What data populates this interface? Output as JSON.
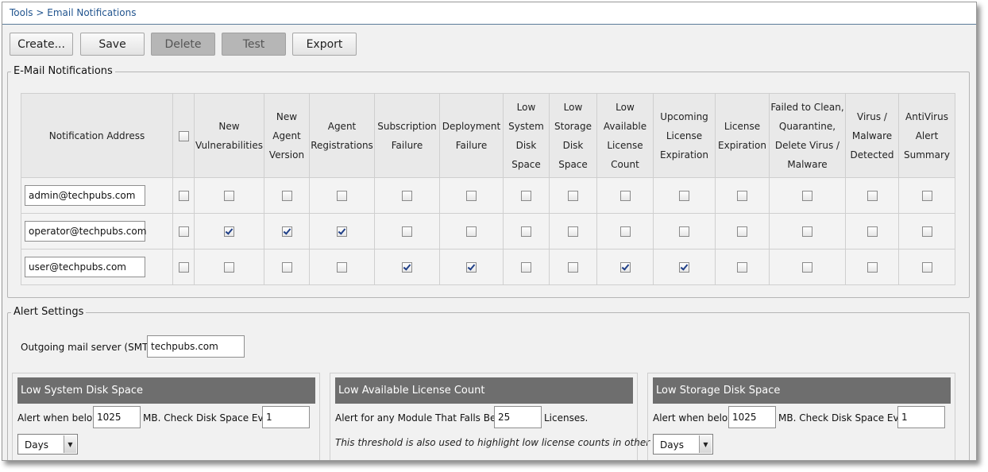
{
  "breadcrumb": "Tools > Email Notifications",
  "toolbar": {
    "create": "Create...",
    "save": "Save",
    "delete": "Delete",
    "test": "Test",
    "export": "Export"
  },
  "notifications": {
    "legend": "E-Mail Notifications",
    "columns": [
      "Notification Address",
      "",
      "New Vulnerabilities",
      "New Agent Version",
      "Agent Registrations",
      "Subscription Failure",
      "Deployment Failure",
      "Low System Disk Space",
      "Low Storage Disk Space",
      "Low Available License Count",
      "Upcoming License Expiration",
      "License Expiration",
      "Failed to Clean, Quarantine, Delete Virus / Malware",
      "Virus / Malware Detected",
      "AntiVirus Alert Summary"
    ],
    "rows": [
      {
        "address": "admin@techpubs.com",
        "checks": [
          false,
          false,
          false,
          false,
          false,
          false,
          false,
          false,
          false,
          false,
          false,
          false,
          false,
          false
        ]
      },
      {
        "address": "operator@techpubs.com",
        "checks": [
          false,
          true,
          true,
          true,
          false,
          false,
          false,
          false,
          false,
          false,
          false,
          false,
          false,
          false
        ]
      },
      {
        "address": "user@techpubs.com",
        "checks": [
          false,
          false,
          false,
          false,
          true,
          true,
          false,
          false,
          true,
          true,
          false,
          false,
          false,
          false
        ]
      }
    ]
  },
  "alert_settings": {
    "legend": "Alert Settings",
    "smtp_label": "Outgoing mail server (SMTP):",
    "smtp_value": "techpubs.com",
    "low_system": {
      "title": "Low System Disk Space",
      "alert_label": "Alert when below",
      "alert_value": "1025",
      "check_label": "MB. Check Disk Space Every",
      "check_value": "1",
      "unit": "Days"
    },
    "low_license": {
      "title": "Low Available License Count",
      "alert_label": "Alert for any Module That Falls Below",
      "alert_value": "25",
      "suffix": "Licenses.",
      "note": "This threshold is also used to highlight low license counts in other areas"
    },
    "low_storage": {
      "title": "Low Storage Disk Space",
      "alert_label": "Alert when below",
      "alert_value": "1025",
      "check_label": "MB. Check Disk Space Every",
      "check_value": "1",
      "unit": "Days"
    }
  }
}
